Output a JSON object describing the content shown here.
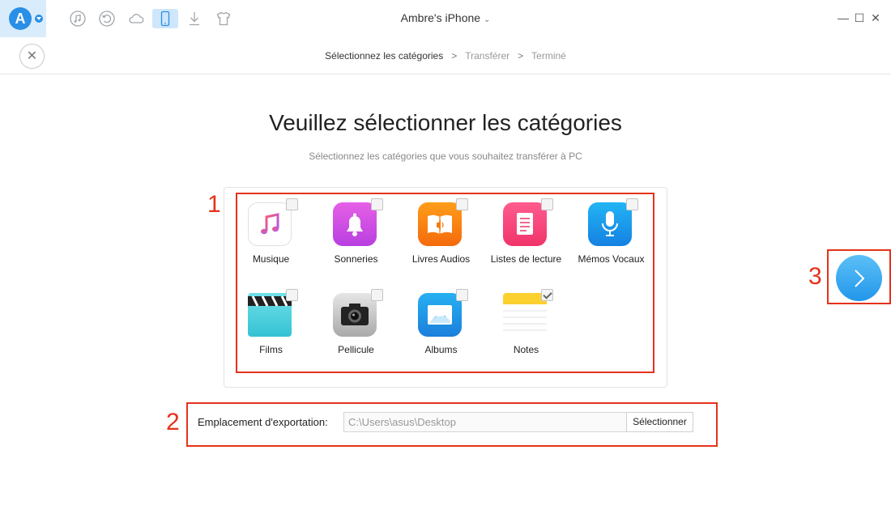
{
  "window": {
    "device_name": "Ambre's iPhone",
    "controls": {
      "minimize": "—",
      "maximize": "☐",
      "close": "✕"
    }
  },
  "toolbar": {
    "logo_letter": "A",
    "icons": [
      "music-icon",
      "history-icon",
      "cloud-icon",
      "phone-icon",
      "download-icon",
      "tshirt-icon"
    ],
    "accent": "#2a8fe6"
  },
  "breadcrumb": {
    "step1": "Sélectionnez les catégories",
    "step2": "Transférer",
    "step3": "Terminé",
    "separator": ">"
  },
  "main": {
    "title": "Veuillez sélectionner les catégories",
    "subtitle": "Sélectionnez les catégories que vous souhaitez transférer à PC"
  },
  "categories": [
    {
      "label": "Musique",
      "checked": false,
      "icon": "music-note-icon"
    },
    {
      "label": "Sonneries",
      "checked": false,
      "icon": "bell-icon"
    },
    {
      "label": "Livres Audios",
      "checked": false,
      "icon": "audiobook-icon"
    },
    {
      "label": "Listes de lecture",
      "checked": false,
      "icon": "playlist-icon"
    },
    {
      "label": "Mémos Vocaux",
      "checked": false,
      "icon": "microphone-icon"
    },
    {
      "label": "Films",
      "checked": false,
      "icon": "clapperboard-icon"
    },
    {
      "label": "Pellicule",
      "checked": false,
      "icon": "camera-icon"
    },
    {
      "label": "Albums",
      "checked": false,
      "icon": "photo-album-icon"
    },
    {
      "label": "Notes",
      "checked": true,
      "icon": "notes-icon"
    }
  ],
  "export": {
    "label": "Emplacement d'exportation:",
    "path": "C:\\Users\\asus\\Desktop",
    "button": "Sélectionner"
  },
  "annotations": {
    "one": "1",
    "two": "2",
    "three": "3",
    "color": "#e5321c"
  }
}
